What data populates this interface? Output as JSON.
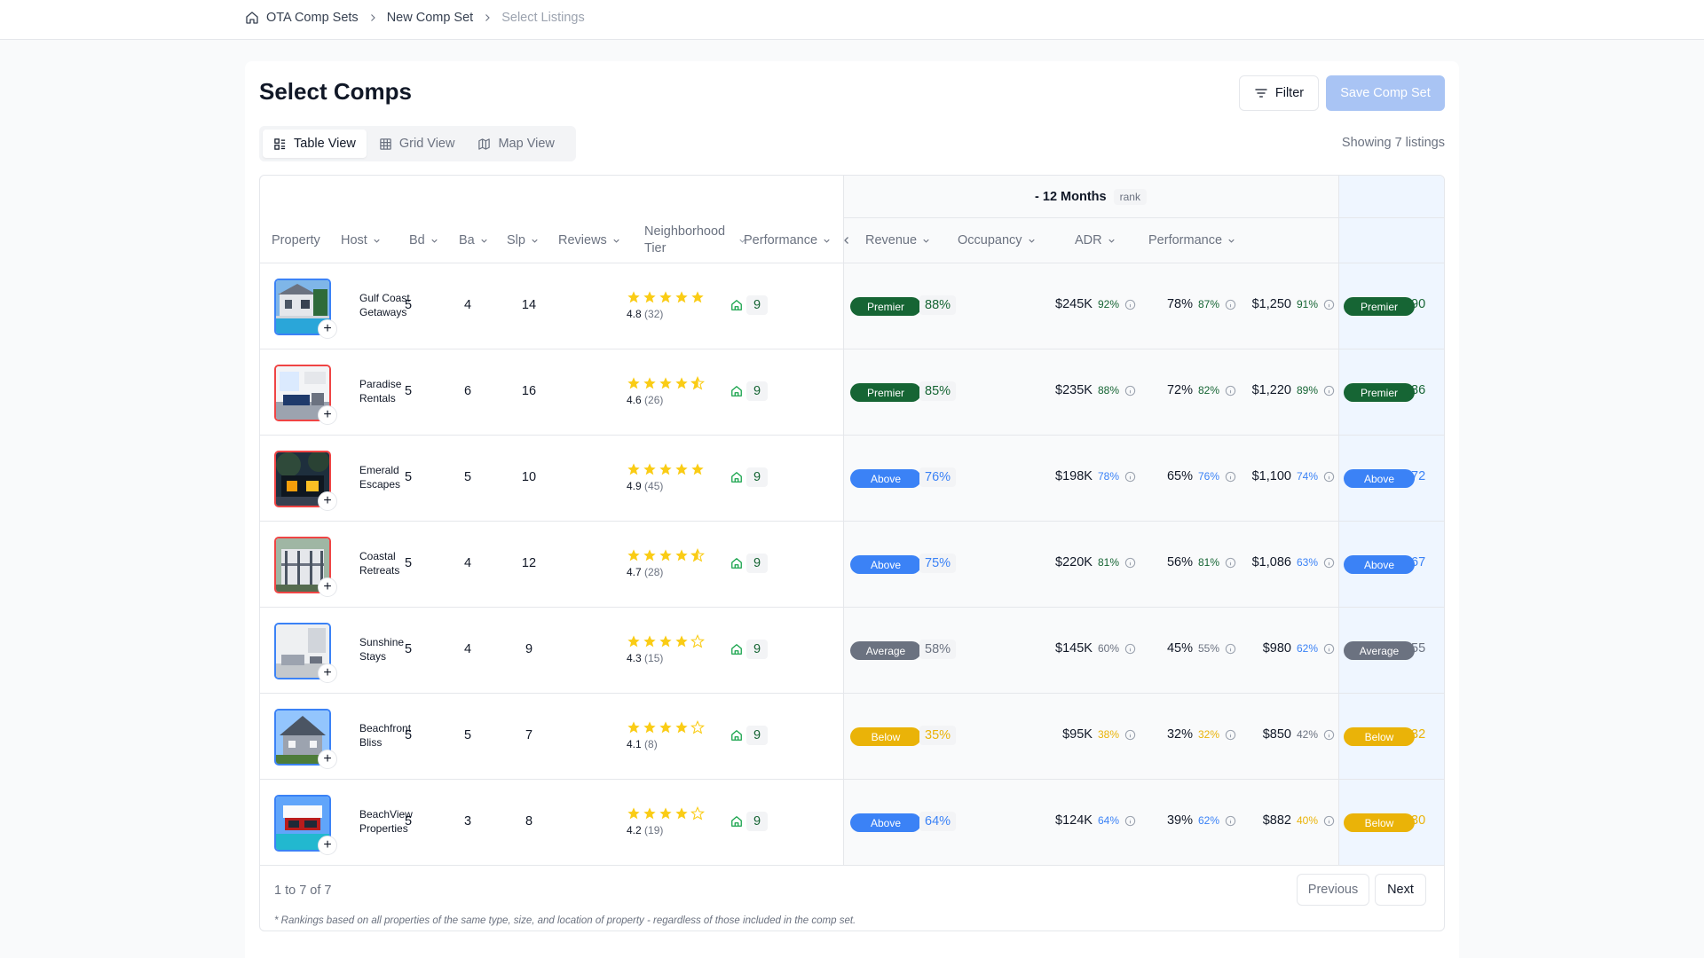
{
  "breadcrumb": {
    "items": [
      {
        "label": "OTA Comp Sets",
        "icon": "home-icon"
      },
      {
        "label": "New Comp Set"
      },
      {
        "label": "Select Listings"
      }
    ]
  },
  "page": {
    "title": "Select Comps",
    "filter_label": "Filter",
    "save_label": "Save Comp Set",
    "showing_text": "Showing 7 listings"
  },
  "tabs": [
    {
      "label": "Table View",
      "icon": "table-view-icon",
      "active": true
    },
    {
      "label": "Grid View",
      "icon": "grid-icon",
      "active": false
    },
    {
      "label": "Map View",
      "icon": "map-icon",
      "active": false
    }
  ],
  "table": {
    "group_header": {
      "title": "- 12 Months",
      "tag": "rank"
    },
    "columns": {
      "property": "Property",
      "host": "Host",
      "bd": "Bd",
      "ba": "Ba",
      "slp": "Slp",
      "reviews": "Reviews",
      "neighborhood_tier": "Neighborhood Tier",
      "performance": "Performance",
      "revenue": "Revenue",
      "occupancy": "Occupancy",
      "adr": "ADR",
      "performance_2": "Performance"
    },
    "rows": [
      {
        "host": "Gulf Coast Getaways",
        "thumb": "pool-villa",
        "border": "blue",
        "bd": "5",
        "ba": "4",
        "slp": "14",
        "stars": 5,
        "rating": "4.8",
        "reviews_count": "(32)",
        "tier": "9",
        "perf": "Premier",
        "perf_pct": "88%",
        "perf_color": "green",
        "revenue": "$245K",
        "revenue_pct": "92%",
        "revenue_color": "green",
        "occupancy": "78%",
        "occupancy_pct": "87%",
        "occupancy_color": "green",
        "adr": "$1,250",
        "adr_pct": "91%",
        "adr_color": "green",
        "perf2": "Premier",
        "perf2_pct": "90",
        "perf2_color": "green"
      },
      {
        "host": "Paradise Rentals",
        "thumb": "living-room",
        "border": "red",
        "bd": "5",
        "ba": "6",
        "slp": "16",
        "stars": 4.5,
        "rating": "4.6",
        "reviews_count": "(26)",
        "tier": "9",
        "perf": "Premier",
        "perf_pct": "85%",
        "perf_color": "green",
        "revenue": "$235K",
        "revenue_pct": "88%",
        "revenue_color": "green",
        "occupancy": "72%",
        "occupancy_pct": "82%",
        "occupancy_color": "green",
        "adr": "$1,220",
        "adr_pct": "89%",
        "adr_color": "green",
        "perf2": "Premier",
        "perf2_pct": "86",
        "perf2_color": "green"
      },
      {
        "host": "Emerald Escapes",
        "thumb": "night-house",
        "border": "red",
        "bd": "5",
        "ba": "5",
        "slp": "10",
        "stars": 5,
        "rating": "4.9",
        "reviews_count": "(45)",
        "tier": "9",
        "perf": "Above",
        "perf_pct": "76%",
        "perf_color": "blue",
        "revenue": "$198K",
        "revenue_pct": "78%",
        "revenue_color": "blue",
        "occupancy": "65%",
        "occupancy_pct": "76%",
        "occupancy_color": "blue",
        "adr": "$1,100",
        "adr_pct": "74%",
        "adr_color": "blue",
        "perf2": "Above",
        "perf2_pct": "72",
        "perf2_color": "blue"
      },
      {
        "host": "Coastal Retreats",
        "thumb": "porch-house",
        "border": "red",
        "bd": "5",
        "ba": "4",
        "slp": "12",
        "stars": 4.5,
        "rating": "4.7",
        "reviews_count": "(28)",
        "tier": "9",
        "perf": "Above",
        "perf_pct": "75%",
        "perf_color": "blue",
        "revenue": "$220K",
        "revenue_pct": "81%",
        "revenue_color": "green",
        "occupancy": "56%",
        "occupancy_pct": "81%",
        "occupancy_color": "green",
        "adr": "$1,086",
        "adr_pct": "63%",
        "adr_color": "blue",
        "perf2": "Above",
        "perf2_pct": "67",
        "perf2_color": "blue"
      },
      {
        "host": "Sunshine Stays",
        "thumb": "white-interior",
        "border": "blue",
        "bd": "5",
        "ba": "4",
        "slp": "9",
        "stars": 4,
        "rating": "4.3",
        "reviews_count": "(15)",
        "tier": "9",
        "perf": "Average",
        "perf_pct": "58%",
        "perf_color": "gray",
        "revenue": "$145K",
        "revenue_pct": "60%",
        "revenue_color": "gray",
        "occupancy": "45%",
        "occupancy_pct": "55%",
        "occupancy_color": "gray",
        "adr": "$980",
        "adr_pct": "62%",
        "adr_color": "blue",
        "perf2": "Average",
        "perf2_pct": "55",
        "perf2_color": "gray"
      },
      {
        "host": "Beachfront Bliss",
        "thumb": "gray-house",
        "border": "blue",
        "bd": "5",
        "ba": "5",
        "slp": "7",
        "stars": 4,
        "rating": "4.1",
        "reviews_count": "(8)",
        "tier": "9",
        "perf": "Below",
        "perf_pct": "35%",
        "perf_color": "yellow",
        "revenue": "$95K",
        "revenue_pct": "38%",
        "revenue_color": "yellow",
        "occupancy": "32%",
        "occupancy_pct": "32%",
        "occupancy_color": "yellow",
        "adr": "$850",
        "adr_pct": "42%",
        "adr_color": "gray",
        "perf2": "Below",
        "perf2_pct": "32",
        "perf2_color": "yellow"
      },
      {
        "host": "BeachView Properties",
        "thumb": "modern-pool",
        "border": "blue",
        "bd": "5",
        "ba": "3",
        "slp": "8",
        "stars": 4,
        "rating": "4.2",
        "reviews_count": "(19)",
        "tier": "9",
        "perf": "Above",
        "perf_pct": "64%",
        "perf_color": "blue",
        "revenue": "$124K",
        "revenue_pct": "64%",
        "revenue_color": "blue",
        "occupancy": "39%",
        "occupancy_pct": "62%",
        "occupancy_color": "blue",
        "adr": "$882",
        "adr_pct": "40%",
        "adr_color": "yellow",
        "perf2": "Below",
        "perf2_pct": "30",
        "perf2_color": "yellow"
      }
    ]
  },
  "footer": {
    "count_text": "1 to 7 of 7",
    "previous_label": "Previous",
    "next_label": "Next",
    "footnote": "* Rankings based on all properties of the same type, size, and location of property - regardless of those included in the comp set."
  },
  "colors": {
    "premier": "#166534",
    "above": "#3b82f6",
    "average": "#6b7280",
    "below": "#eab308",
    "star": "#facc15"
  }
}
